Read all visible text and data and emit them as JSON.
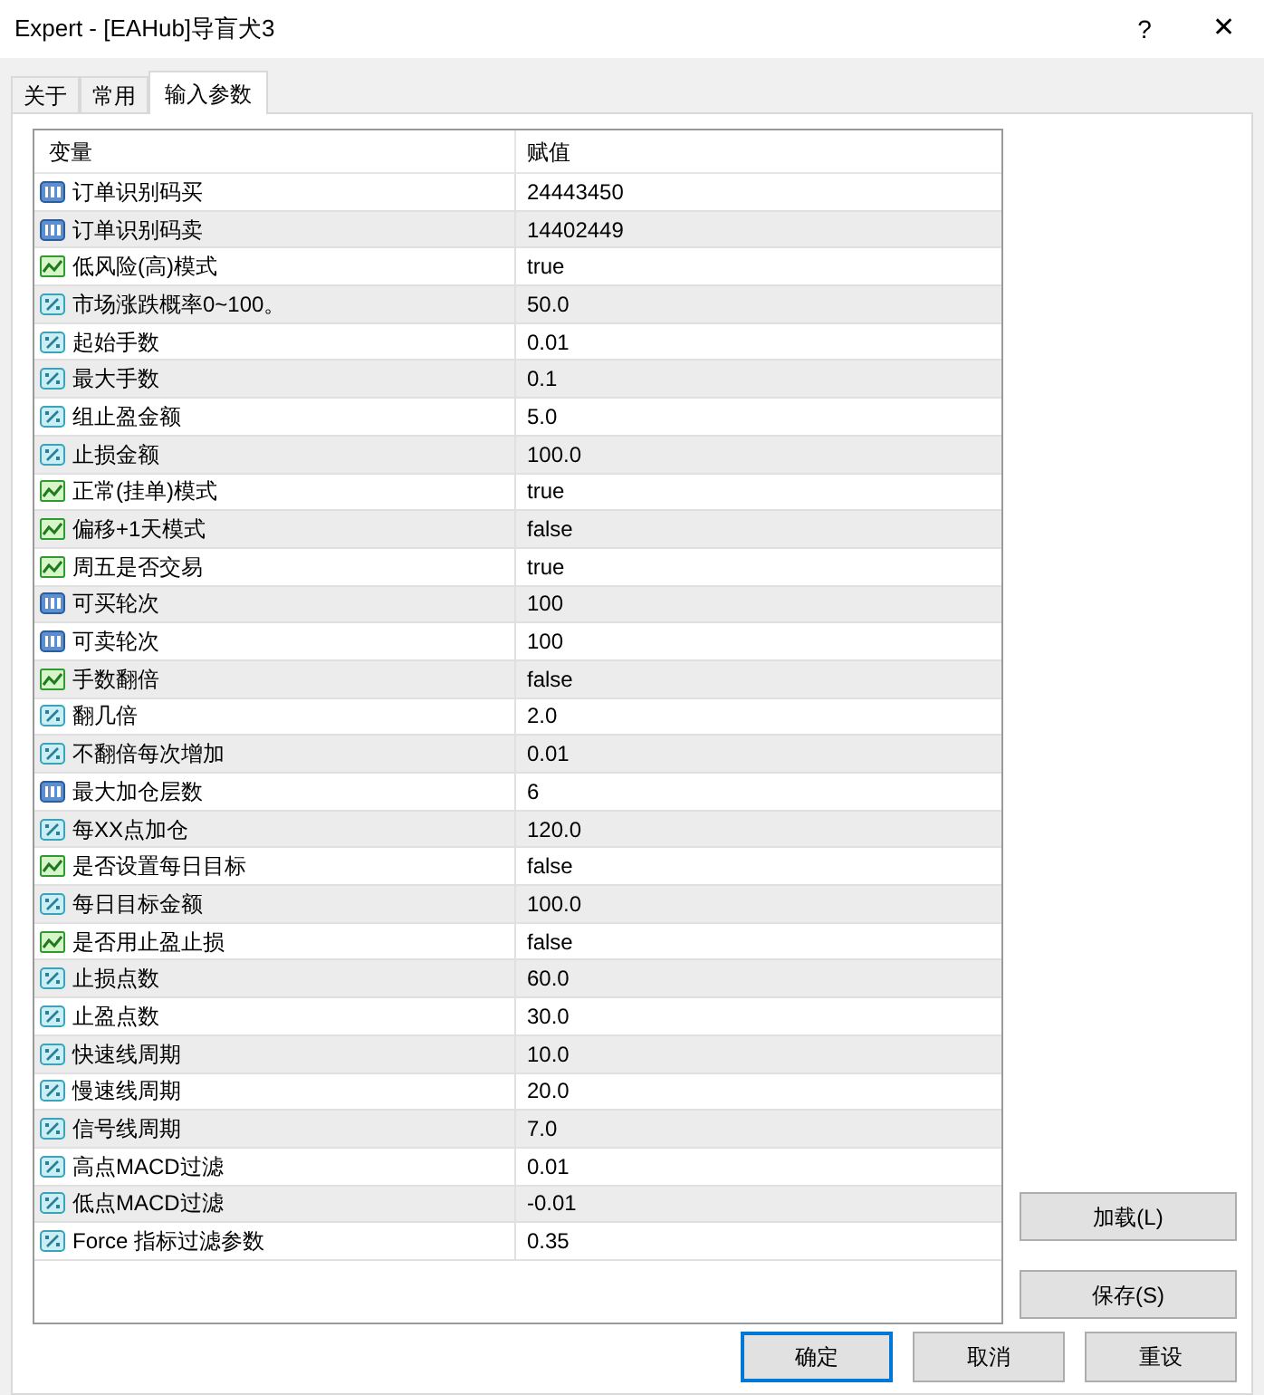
{
  "window": {
    "title": "Expert - [EAHub]导盲犬3",
    "help": "?",
    "close": "✕"
  },
  "tabs": [
    {
      "label": "关于",
      "selected": false
    },
    {
      "label": "常用",
      "selected": false
    },
    {
      "label": "输入参数",
      "selected": true
    }
  ],
  "table": {
    "columns": [
      "变量",
      "赋值"
    ],
    "rows": [
      {
        "kind": "int",
        "name": "订单识别码买",
        "value": "24443450"
      },
      {
        "kind": "int",
        "name": "订单识别码卖",
        "value": "14402449"
      },
      {
        "kind": "bool",
        "name": "低风险(高)模式",
        "value": "true"
      },
      {
        "kind": "double",
        "name": "市场涨跌概率0~100。",
        "value": "50.0"
      },
      {
        "kind": "double",
        "name": "起始手数",
        "value": "0.01"
      },
      {
        "kind": "double",
        "name": "最大手数",
        "value": "0.1"
      },
      {
        "kind": "double",
        "name": "组止盈金额",
        "value": "5.0"
      },
      {
        "kind": "double",
        "name": "止损金额",
        "value": "100.0"
      },
      {
        "kind": "bool",
        "name": "正常(挂单)模式",
        "value": "true"
      },
      {
        "kind": "bool",
        "name": "偏移+1天模式",
        "value": "false"
      },
      {
        "kind": "bool",
        "name": "周五是否交易",
        "value": "true"
      },
      {
        "kind": "int",
        "name": "可买轮次",
        "value": "100"
      },
      {
        "kind": "int",
        "name": "可卖轮次",
        "value": "100"
      },
      {
        "kind": "bool",
        "name": "手数翻倍",
        "value": "false"
      },
      {
        "kind": "double",
        "name": "翻几倍",
        "value": "2.0"
      },
      {
        "kind": "double",
        "name": "不翻倍每次增加",
        "value": "0.01"
      },
      {
        "kind": "int",
        "name": "最大加仓层数",
        "value": "6"
      },
      {
        "kind": "double",
        "name": "每XX点加仓",
        "value": "120.0"
      },
      {
        "kind": "bool",
        "name": "是否设置每日目标",
        "value": "false"
      },
      {
        "kind": "double",
        "name": "每日目标金额",
        "value": "100.0"
      },
      {
        "kind": "bool",
        "name": "是否用止盈止损",
        "value": "false"
      },
      {
        "kind": "double",
        "name": "止损点数",
        "value": "60.0"
      },
      {
        "kind": "double",
        "name": "止盈点数",
        "value": "30.0"
      },
      {
        "kind": "double",
        "name": "快速线周期",
        "value": "10.0"
      },
      {
        "kind": "double",
        "name": "慢速线周期",
        "value": "20.0"
      },
      {
        "kind": "double",
        "name": "信号线周期",
        "value": "7.0"
      },
      {
        "kind": "double",
        "name": "高点MACD过滤",
        "value": "0.01"
      },
      {
        "kind": "double",
        "name": "低点MACD过滤",
        "value": "-0.01"
      },
      {
        "kind": "double",
        "name": "Force 指标过滤参数",
        "value": "0.35"
      }
    ]
  },
  "side_buttons": [
    "加载(L)",
    "保存(S)"
  ],
  "footer_buttons": [
    {
      "label": "确定",
      "focused": true
    },
    {
      "label": "取消",
      "focused": false
    },
    {
      "label": "重设",
      "focused": false
    }
  ]
}
